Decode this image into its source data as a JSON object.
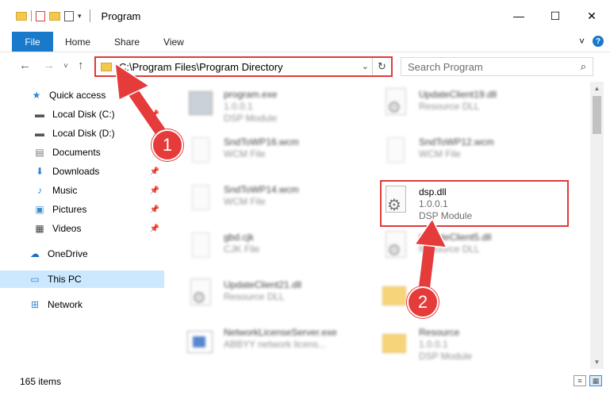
{
  "window": {
    "title": "Program",
    "controls": {
      "minimize": "—",
      "maximize": "☐",
      "close": "✕"
    }
  },
  "ribbon": {
    "tabs": [
      "File",
      "Home",
      "Share",
      "View"
    ],
    "collapse_glyph": "˅",
    "help_glyph": "?"
  },
  "address": {
    "path": "C:\\Program Files\\Program Directory",
    "dropdown_glyph": "⌄",
    "refresh_glyph": "↻",
    "back_glyph": "←",
    "forward_glyph": "→",
    "recent_glyph": "˅",
    "up_glyph": "↑"
  },
  "search": {
    "placeholder": "Search Program",
    "icon_glyph": "⌕"
  },
  "nav": {
    "quick_access": "Quick access",
    "items": [
      {
        "label": "Local Disk (C:)",
        "icon": "drive-icon"
      },
      {
        "label": "Local Disk (D:)",
        "icon": "drive-icon"
      },
      {
        "label": "Documents",
        "icon": "documents-icon"
      },
      {
        "label": "Downloads",
        "icon": "downloads-icon"
      },
      {
        "label": "Music",
        "icon": "music-icon"
      },
      {
        "label": "Pictures",
        "icon": "pictures-icon"
      },
      {
        "label": "Videos",
        "icon": "videos-icon"
      }
    ],
    "onedrive": "OneDrive",
    "this_pc": "This PC",
    "network": "Network"
  },
  "files": [
    {
      "name": "program.exe",
      "line2": "1.0.0.1",
      "line3": "DSP Module",
      "icon": "exe-icon"
    },
    {
      "name": "UpdateClient19.dll",
      "line2": "Resource DLL",
      "line3": "",
      "icon": "dll-icon"
    },
    {
      "name": "SndToWP16.wcm",
      "line2": "WCM File",
      "line3": "",
      "icon": "document-icon"
    },
    {
      "name": "SndToWP12.wcm",
      "line2": "WCM File",
      "line3": "",
      "icon": "document-icon"
    },
    {
      "name": "SndToWP14.wcm",
      "line2": "WCM File",
      "line3": "",
      "icon": "document-icon"
    },
    {
      "name": "dsp.dll",
      "line2": "1.0.0.1",
      "line3": "DSP Module",
      "icon": "dll-icon"
    },
    {
      "name": "gbd.cjk",
      "line2": "CJK File",
      "line3": "",
      "icon": "document-icon"
    },
    {
      "name": "UpdateClient5.dll",
      "line2": "Resource DLL",
      "line3": "",
      "icon": "dll-icon"
    },
    {
      "name": "UpdateClient21.dll",
      "line2": "Resource DLL",
      "line3": "",
      "icon": "dll-icon"
    },
    {
      "name": "14",
      "line2": "",
      "line3": "",
      "icon": "folder-icon"
    },
    {
      "name": "NetworkLicenseServer.exe",
      "line2": "ABBYY network licens...",
      "line3": "",
      "icon": "app-icon"
    },
    {
      "name": "Resource",
      "line2": "1.0.0.1",
      "line3": "DSP Module",
      "icon": "folder-icon"
    }
  ],
  "status": {
    "item_count": "165 items"
  },
  "annotations": {
    "step1": "1",
    "step2": "2"
  },
  "colors": {
    "accent": "#1979ca",
    "highlight": "#e03a3a",
    "selected": "#cce8ff"
  }
}
